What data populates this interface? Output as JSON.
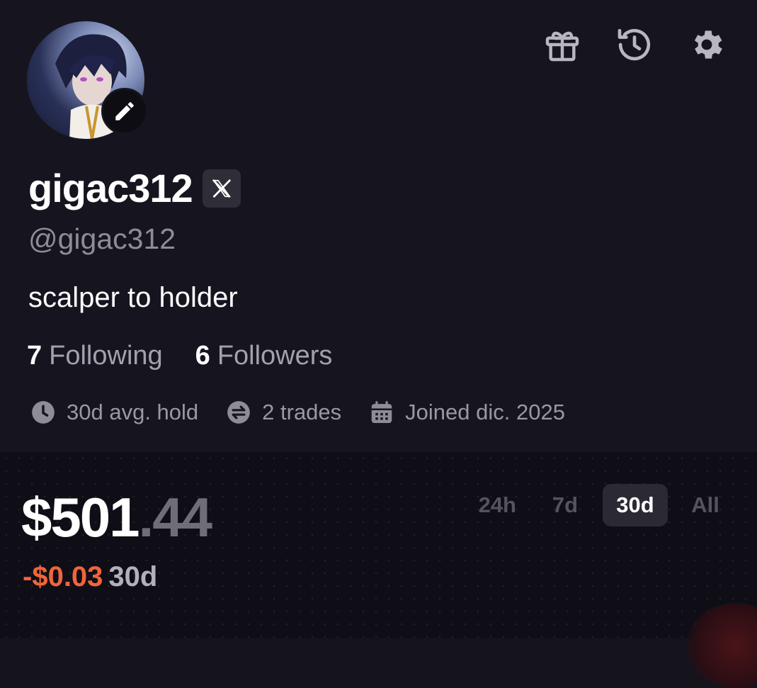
{
  "profile": {
    "display_name": "gigac312",
    "handle": "@gigac312",
    "bio": "scalper to holder",
    "following_count": "7",
    "following_label": "Following",
    "followers_count": "6",
    "followers_label": "Followers",
    "meta": {
      "hold": "30d avg. hold",
      "trades": "2 trades",
      "joined": "Joined dic. 2025"
    },
    "icons": {
      "avatar": "avatar",
      "edit": "pencil-icon",
      "x": "x-logo-icon",
      "gift": "gift-icon",
      "history": "history-icon",
      "settings": "gear-icon",
      "clock": "clock-icon",
      "swap": "swap-icon",
      "calendar": "calendar-icon"
    }
  },
  "portfolio": {
    "balance_whole": "$501",
    "balance_cents": ".44",
    "change_value": "-$0.03",
    "change_period": "30d",
    "tabs": [
      {
        "label": "24h",
        "active": false
      },
      {
        "label": "7d",
        "active": false
      },
      {
        "label": "30d",
        "active": true
      },
      {
        "label": "All",
        "active": false
      }
    ]
  },
  "colors": {
    "background": "#16151f",
    "negative": "#f2643a",
    "muted": "#8e8c97",
    "active_tab": "#2b2a34"
  }
}
